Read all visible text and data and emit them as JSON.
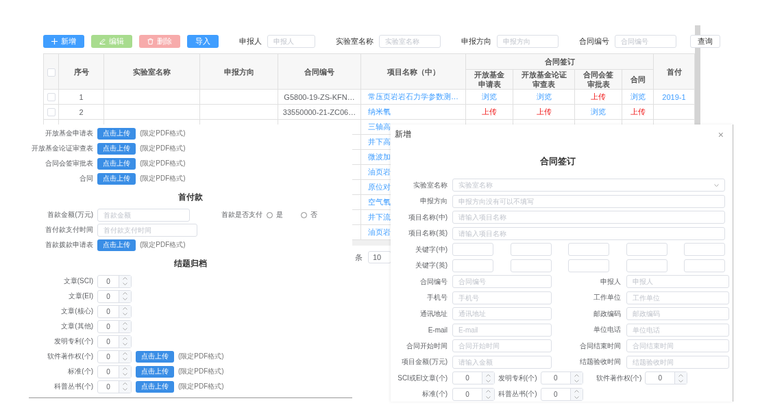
{
  "table_page": {
    "toolbar": {
      "buttons": [
        {
          "label": "新增",
          "kind": "add",
          "disabled": false
        },
        {
          "label": "编辑",
          "kind": "edit",
          "disabled": true
        },
        {
          "label": "删除",
          "kind": "delete",
          "disabled": true
        },
        {
          "label": "导入",
          "kind": "import",
          "disabled": false
        }
      ],
      "filters": [
        {
          "label": "申报人",
          "placeholder": "申报人"
        },
        {
          "label": "实验室名称",
          "placeholder": "实验室名称"
        },
        {
          "label": "申报方向",
          "placeholder": "申报方向"
        },
        {
          "label": "合同编号",
          "placeholder": "合同编号"
        }
      ],
      "query_button": "查询"
    },
    "table": {
      "all_selected": false,
      "columns": [
        {
          "label": "序号"
        },
        {
          "label": "实验室名称"
        },
        {
          "label": "申报方向"
        },
        {
          "label": "合同编号"
        },
        {
          "label": "项目名称（中）"
        },
        {
          "label": "合同签订",
          "children": [
            {
              "lines": [
                "开放基金",
                "申请表"
              ]
            },
            {
              "lines": [
                "开放基金论证",
                "审查表"
              ]
            },
            {
              "lines": [
                "合同会签",
                "审批表"
              ]
            },
            {
              "lines": [
                "合同"
              ]
            }
          ]
        },
        {
          "label": "首付"
        }
      ],
      "rows": [
        {
          "selected": false,
          "index": "1",
          "contract_no": "G5800-19-ZS-KFN…",
          "project": "常压页岩岩石力学参数测…",
          "files": [
            {
              "text": "浏览",
              "kind": "view"
            },
            {
              "text": "浏览",
              "kind": "view"
            },
            {
              "text": "上传",
              "kind": "upload"
            },
            {
              "text": "浏览",
              "kind": "view"
            }
          ],
          "first_payment": "2019-1"
        },
        {
          "selected": false,
          "index": "2",
          "contract_no": "33550000-21-ZC06…",
          "project": "纳米氧",
          "files": [
            {
              "text": "上传",
              "kind": "upload"
            },
            {
              "text": "上传",
              "kind": "upload"
            },
            {
              "text": "浏览",
              "kind": "view"
            },
            {
              "text": "上传",
              "kind": "upload"
            }
          ]
        },
        {
          "project": "三轴高"
        },
        {
          "project": "井下高"
        },
        {
          "project": "微波加"
        },
        {
          "project": "油页岩"
        },
        {
          "project": "原位对"
        },
        {
          "project": "空气氧"
        },
        {
          "project": "井下流"
        },
        {
          "project": "油页岩"
        }
      ]
    },
    "pagination": {
      "suffix": "条",
      "page_size": "10"
    }
  },
  "upload_form": {
    "sections": [
      {
        "rows": [
          {
            "kind": "upload",
            "label": "开放基金申请表",
            "button": "点击上传",
            "note": "(限定PDF格式)"
          },
          {
            "kind": "upload",
            "label": "开放基金论证审查表",
            "button": "点击上传",
            "note": "(限定PDF格式)"
          },
          {
            "kind": "upload",
            "label": "合同会签审批表",
            "button": "点击上传",
            "note": "(限定PDF格式)"
          },
          {
            "kind": "upload",
            "label": "合同",
            "button": "点击上传",
            "note": "(限定PDF格式)"
          }
        ]
      },
      {
        "title": "首付款",
        "rows": [
          {
            "kind": "text_radio",
            "label": "首款金额(万元)",
            "placeholder": "首款金额",
            "radio_label": "首款是否支付",
            "options": [
              {
                "label": "是",
                "selected": false
              },
              {
                "label": "否",
                "selected": false
              }
            ]
          },
          {
            "kind": "text",
            "label": "首付款支付时间",
            "placeholder": "首付款支付时间"
          },
          {
            "kind": "upload",
            "label": "首款拨款申请表",
            "button": "点击上传",
            "note": "(限定PDF格式)"
          }
        ]
      },
      {
        "title": "结题归档",
        "rows": [
          {
            "kind": "number",
            "label": "文章(SCI)",
            "value": "0"
          },
          {
            "kind": "number",
            "label": "文章(EI)",
            "value": "0"
          },
          {
            "kind": "number",
            "label": "文章(核心)",
            "value": "0"
          },
          {
            "kind": "number",
            "label": "文章(其他)",
            "value": "0"
          },
          {
            "kind": "number",
            "label": "发明专利(个)",
            "value": "0"
          },
          {
            "kind": "number_upload",
            "label": "软件著作权(个)",
            "value": "0",
            "button": "点击上传",
            "note": "(限定PDF格式)"
          },
          {
            "kind": "number_upload",
            "label": "标准(个)",
            "value": "0",
            "button": "点击上传",
            "note": "(限定PDF格式)"
          },
          {
            "kind": "number_upload",
            "label": "科普丛书(个)",
            "value": "0",
            "button": "点击上传",
            "note": "(限定PDF格式)"
          }
        ]
      }
    ]
  },
  "dialog": {
    "title": "新增",
    "close": "×",
    "heading": "合同签订",
    "rows": [
      {
        "kind": "select",
        "label": "实验室名称",
        "placeholder": "实验室名称"
      },
      {
        "kind": "text",
        "label": "申报方向",
        "placeholder": "申报方向没有可以不填写"
      },
      {
        "kind": "text",
        "label": "项目名称(中)",
        "placeholder": "请输入项目名称"
      },
      {
        "kind": "text",
        "label": "项目名称(英)",
        "placeholder": "请输入项目名称"
      },
      {
        "kind": "keywords",
        "label": "关键字(中)"
      },
      {
        "kind": "keywords",
        "label": "关键字(英)"
      },
      {
        "kind": "pair",
        "fields": [
          {
            "label": "合同编号",
            "placeholder": "合同编号"
          },
          {
            "label": "申报人",
            "placeholder": "申报人"
          }
        ]
      },
      {
        "kind": "pair",
        "fields": [
          {
            "label": "手机号",
            "placeholder": "手机号"
          },
          {
            "label": "工作单位",
            "placeholder": "工作单位"
          }
        ]
      },
      {
        "kind": "pair",
        "fields": [
          {
            "label": "通讯地址",
            "placeholder": "通讯地址"
          },
          {
            "label": "邮政编码",
            "placeholder": "邮政编码"
          }
        ]
      },
      {
        "kind": "pair",
        "fields": [
          {
            "label": "E-mail",
            "placeholder": "E-mail"
          },
          {
            "label": "单位电话",
            "placeholder": "单位电话"
          }
        ]
      },
      {
        "kind": "pair",
        "fields": [
          {
            "label": "合同开始时间",
            "placeholder": "合同开始时间"
          },
          {
            "label": "合同结束时间",
            "placeholder": "合同结束时间"
          }
        ]
      },
      {
        "kind": "pair",
        "fields": [
          {
            "label": "项目金额(万元)",
            "placeholder": "请输入金额"
          },
          {
            "label": "结题验收时间",
            "placeholder": "结题验收时间"
          }
        ]
      },
      {
        "kind": "numbers",
        "fields": [
          {
            "label": "SCI或EI文章(个)",
            "value": "0"
          },
          {
            "label": "发明专利(个)",
            "value": "0"
          },
          {
            "label": "软件著作权(个)",
            "value": "0"
          }
        ]
      },
      {
        "kind": "numbers",
        "fields": [
          {
            "label": "标准(个)",
            "value": "0"
          },
          {
            "label": "科普丛书(个)",
            "value": "0"
          }
        ]
      }
    ]
  }
}
